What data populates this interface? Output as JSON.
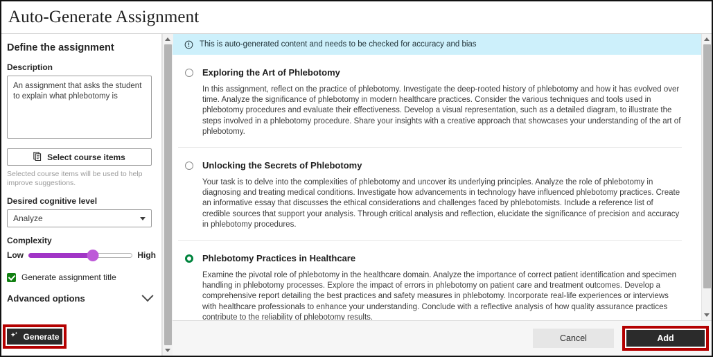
{
  "header": {
    "title": "Auto-Generate Assignment"
  },
  "left": {
    "heading": "Define the assignment",
    "description_label": "Description",
    "description_value": "An assignment that asks the student to explain what phlebotomy is",
    "description_placeholder": "",
    "select_course_items_label": "Select course items",
    "select_course_items_icon": "documents-icon",
    "hint": "Selected course items will be used to help improve suggestions.",
    "cognitive_label": "Desired cognitive level",
    "cognitive_value": "Analyze",
    "complexity_label": "Complexity",
    "complexity_low": "Low",
    "complexity_high": "High",
    "complexity_percent": 62,
    "generate_title_label": "Generate assignment title",
    "generate_title_checked": true,
    "advanced_options_label": "Advanced options",
    "generate_label": "Generate",
    "generate_icon": "sparkle-icon"
  },
  "banner": {
    "icon": "exclamation-circle-icon",
    "text": "This is auto-generated content and needs to be checked for accuracy and bias"
  },
  "suggestions": [
    {
      "title": "Exploring the Art of Phlebotomy",
      "selected": false,
      "body": "In this assignment, reflect on the practice of phlebotomy. Investigate the deep-rooted history of phlebotomy and how it has evolved over time. Analyze the significance of phlebotomy in modern healthcare practices. Consider the various techniques and tools used in phlebotomy procedures and evaluate their effectiveness. Develop a visual representation, such as a detailed diagram, to illustrate the steps involved in a phlebotomy procedure. Share your insights with a creative approach that showcases your understanding of the art of phlebotomy."
    },
    {
      "title": "Unlocking the Secrets of Phlebotomy",
      "selected": false,
      "body": "Your task is to delve into the complexities of phlebotomy and uncover its underlying principles. Analyze the role of phlebotomy in diagnosing and treating medical conditions. Investigate how advancements in technology have influenced phlebotomy practices. Create an informative essay that discusses the ethical considerations and challenges faced by phlebotomists. Include a reference list of credible sources that support your analysis. Through critical analysis and reflection, elucidate the significance of precision and accuracy in phlebotomy procedures."
    },
    {
      "title": "Phlebotomy Practices in Healthcare",
      "selected": true,
      "body": "Examine the pivotal role of phlebotomy in the healthcare domain. Analyze the importance of correct patient identification and specimen handling in phlebotomy processes. Explore the impact of errors in phlebotomy on patient care and treatment outcomes. Develop a comprehensive report detailing the best practices and safety measures in phlebotomy. Incorporate real-life experiences or interviews with healthcare professionals to enhance your understanding. Conclude with a reflective analysis of how quality assurance practices contribute to the reliability of phlebotomy results."
    }
  ],
  "footer": {
    "cancel_label": "Cancel",
    "add_label": "Add"
  },
  "colors": {
    "highlight": "#b40000",
    "banner_bg": "#cdf0fb",
    "slider": "#a135c6",
    "checkbox": "#118011",
    "radio_selected": "#00843d",
    "button_dark": "#2b2b2b"
  }
}
